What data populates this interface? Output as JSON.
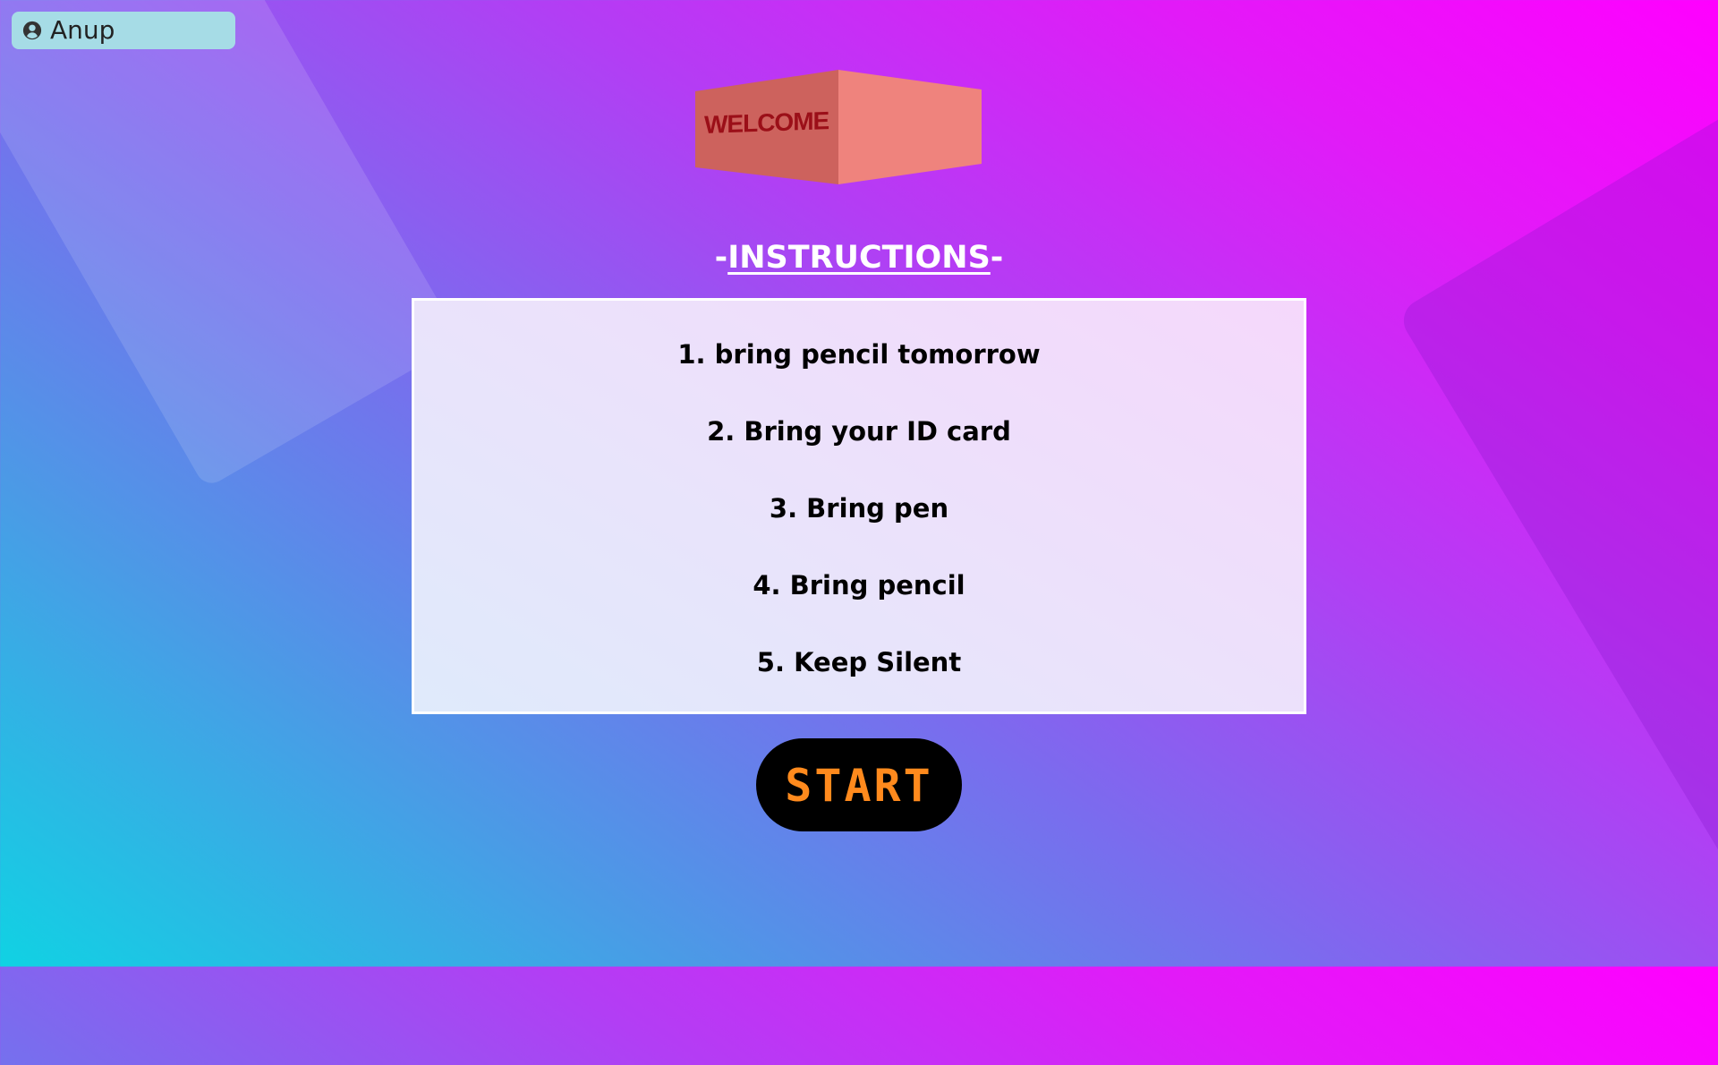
{
  "user": {
    "name": "Anup",
    "icon": "user-circle-icon"
  },
  "welcome": {
    "label": "WELCOME",
    "colors": {
      "left_face": "#cd625d",
      "right_face": "#ef837d",
      "text": "#9b0f18"
    }
  },
  "instructions": {
    "title_prefix": "-",
    "title": "INSTRUCTIONS",
    "title_suffix": "-",
    "items": [
      "1. bring pencil tomorrow",
      "2. Bring your ID card",
      "3. Bring pen",
      "4. Bring pencil",
      "5. Keep Silent"
    ]
  },
  "start_button": {
    "label": "START",
    "background": "#000000",
    "text_color": "#ff8a1d"
  }
}
